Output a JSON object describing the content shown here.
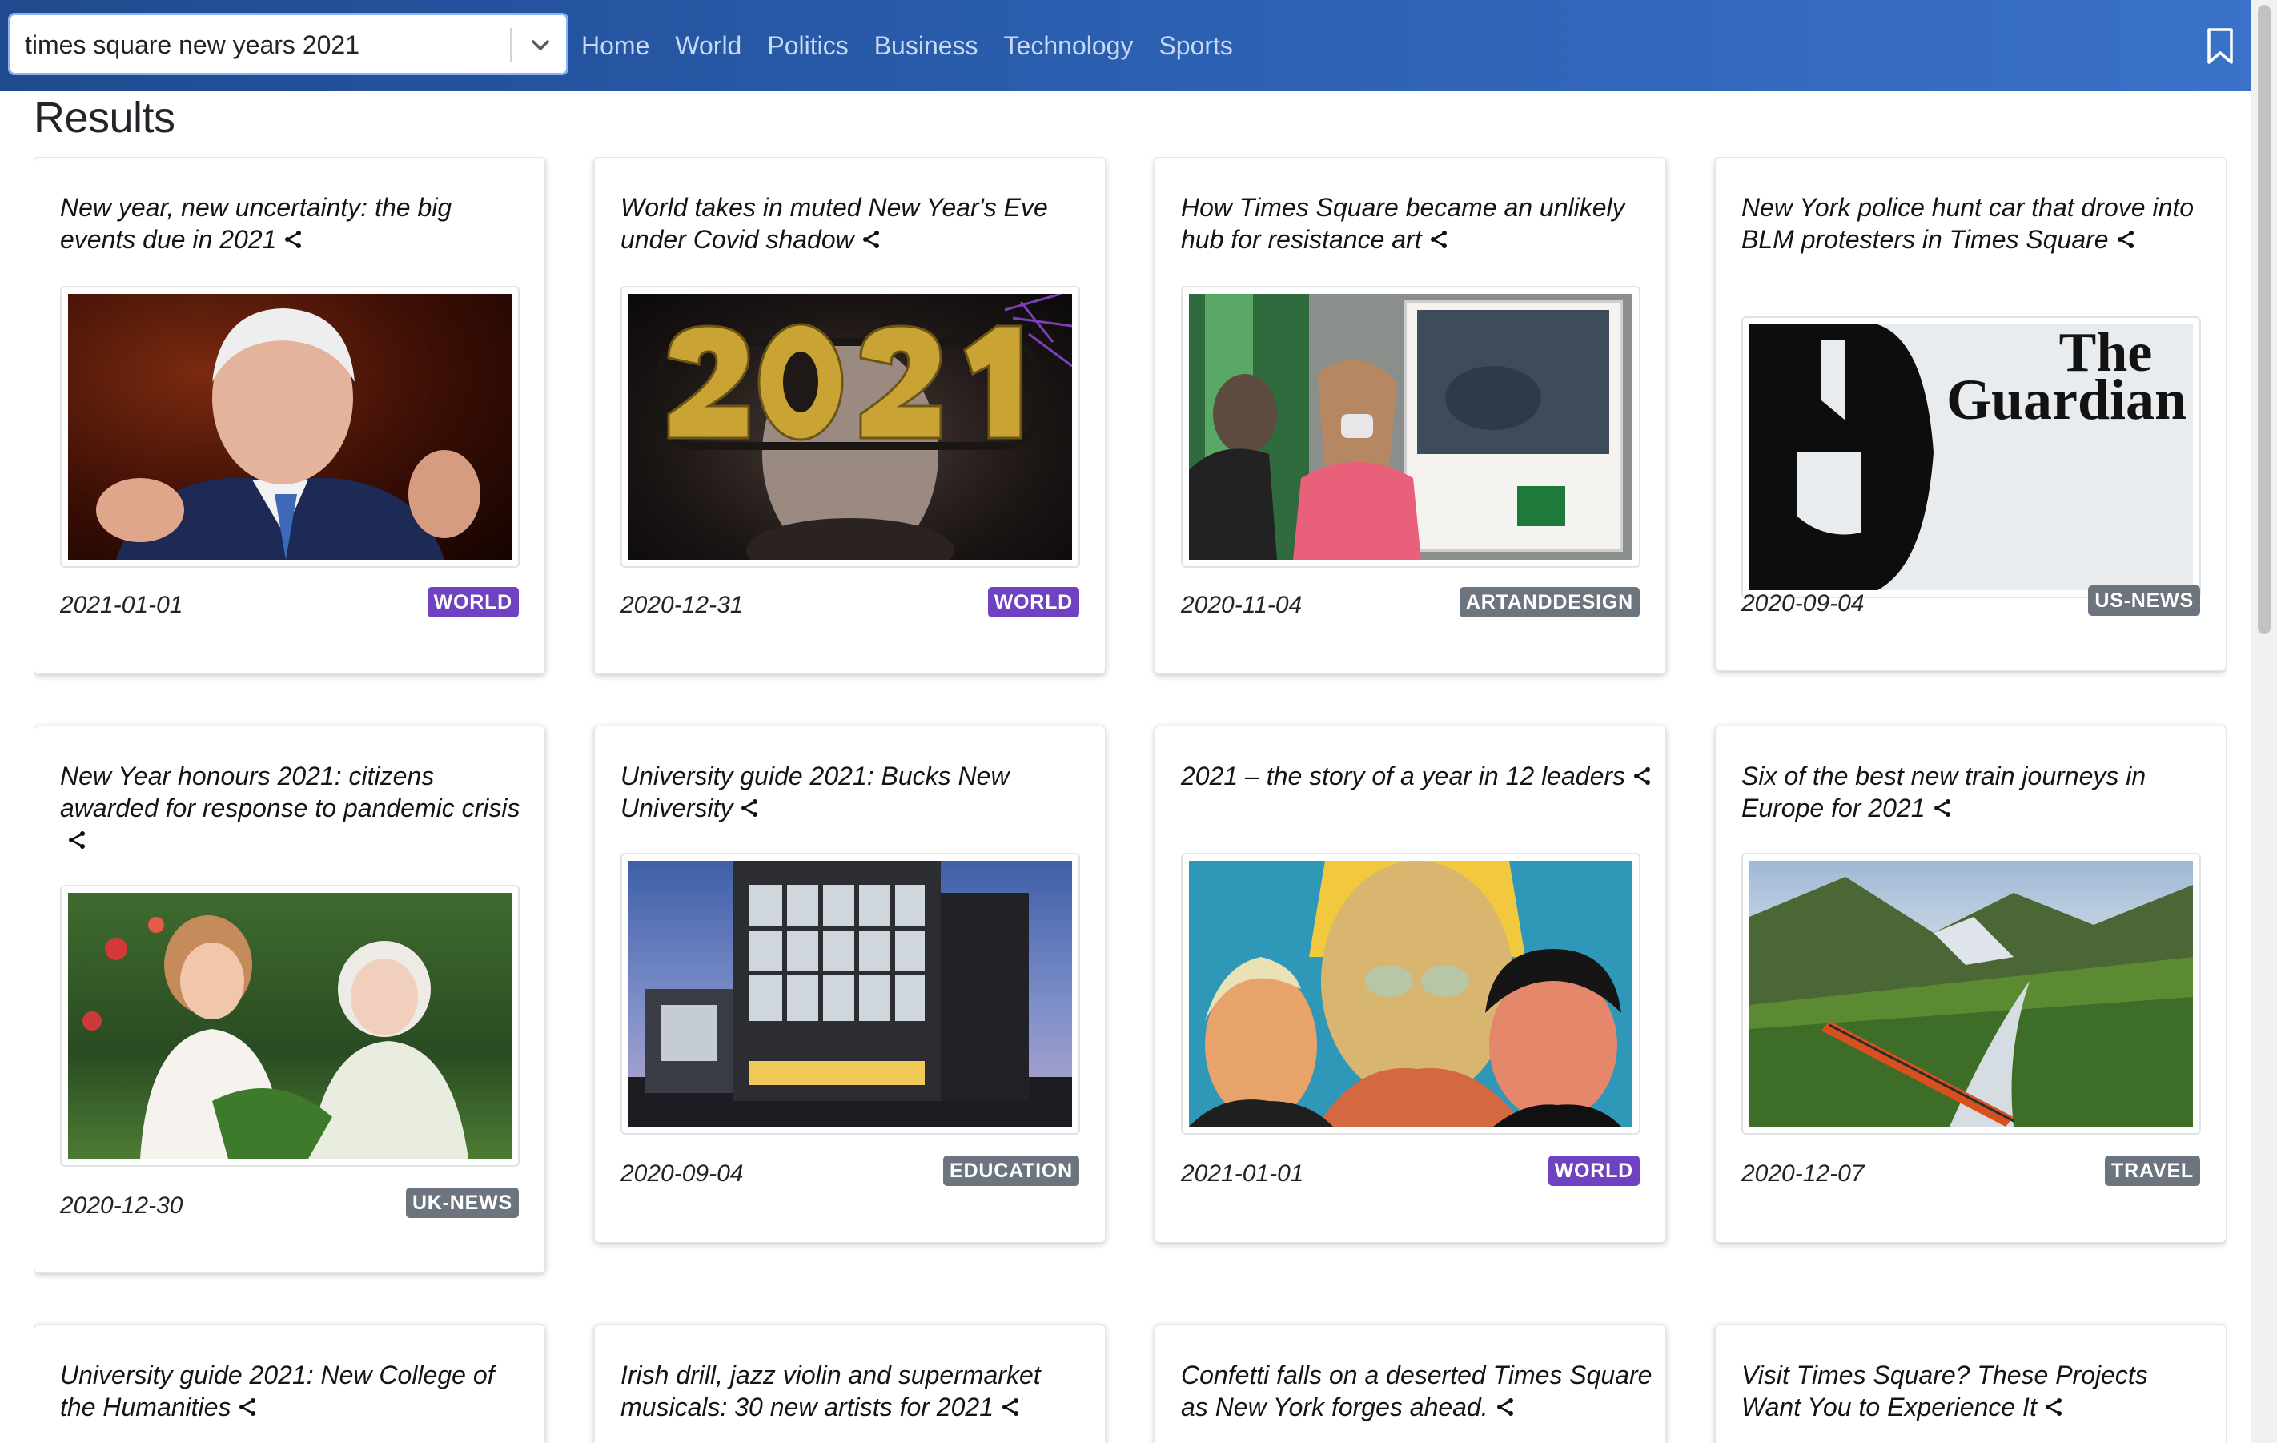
{
  "search": {
    "value": "times square new years 2021"
  },
  "nav": {
    "links": [
      {
        "label": "Home"
      },
      {
        "label": "World"
      },
      {
        "label": "Politics"
      },
      {
        "label": "Business"
      },
      {
        "label": "Technology"
      },
      {
        "label": "Sports"
      }
    ]
  },
  "page": {
    "title": "Results"
  },
  "colors": {
    "world": "#6f42c1",
    "default_badge": "#6c757d",
    "navbar": "#2b5fb0"
  },
  "results": [
    {
      "title": "New year, new uncertainty: the big events due in 2021",
      "date": "2021-01-01",
      "section": "WORLD",
      "image": "joe-biden-speaking-photo"
    },
    {
      "title": "World takes in muted New Year's Eve under Covid shadow",
      "date": "2020-12-31",
      "section": "WORLD",
      "image": "2021-glasses-photo"
    },
    {
      "title": "How Times Square became an unlikely hub for resistance art",
      "date": "2020-11-04",
      "section": "ARTANDDESIGN",
      "image": "times-square-street-photo"
    },
    {
      "title": "New York police hunt car that drove into BLM protesters in Times Square",
      "date": "2020-09-04",
      "section": "US-NEWS",
      "image": "the-guardian-logo",
      "logo_text_1": "The",
      "logo_text_2": "Guardian"
    },
    {
      "title": "New Year honours 2021: citizens awarded for response to pandemic crisis",
      "date": "2020-12-30",
      "section": "UK-NEWS",
      "image": "garden-women-photo"
    },
    {
      "title": "University guide 2021: Bucks New University",
      "date": "2020-09-04",
      "section": "EDUCATION",
      "image": "university-building-photo"
    },
    {
      "title": "2021 – the story of a year in 12 leaders",
      "date": "2021-01-01",
      "section": "WORLD",
      "image": "leaders-illustration"
    },
    {
      "title": "Six of the best new train journeys in Europe for 2021",
      "date": "2020-12-07",
      "section": "TRAVEL",
      "image": "alpine-train-photo"
    },
    {
      "title": "University guide 2021: New College of the Humanities",
      "date": "",
      "section": "",
      "image": ""
    },
    {
      "title": "Irish drill, jazz violin and supermarket musicals: 30 new artists for 2021",
      "date": "",
      "section": "",
      "image": ""
    },
    {
      "title": "Confetti falls on a deserted Times Square as New York forges ahead.",
      "date": "",
      "section": "",
      "image": ""
    },
    {
      "title": "Visit Times Square? These Projects Want You to Experience It",
      "date": "",
      "section": "",
      "image": ""
    }
  ]
}
